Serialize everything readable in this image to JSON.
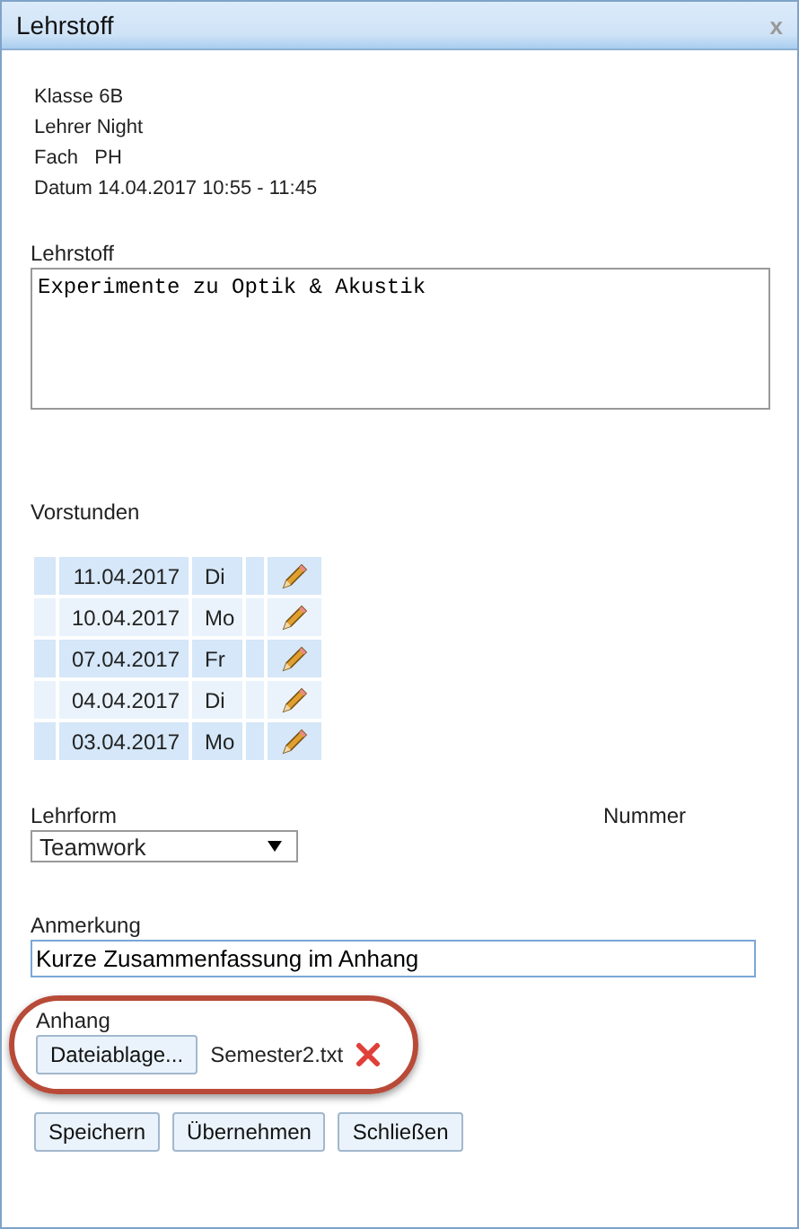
{
  "window": {
    "title": "Lehrstoff",
    "close": "x"
  },
  "info": [
    "Klasse 6B",
    "Lehrer Night",
    "Fach   PH",
    "Datum 14.04.2017 10:55 - 11:45"
  ],
  "lehrstoff": {
    "label": "Lehrstoff",
    "value": "Experimente zu Optik & Akustik"
  },
  "vorstunden": {
    "label": "Vorstunden",
    "rows": [
      {
        "date": "11.04.2017",
        "day": "Di"
      },
      {
        "date": "10.04.2017",
        "day": "Mo"
      },
      {
        "date": "07.04.2017",
        "day": "Fr"
      },
      {
        "date": "04.04.2017",
        "day": "Di"
      },
      {
        "date": "03.04.2017",
        "day": "Mo"
      }
    ]
  },
  "lehrform": {
    "label": "Lehrform",
    "value": "Teamwork"
  },
  "nummer": {
    "label": "Nummer"
  },
  "anmerkung": {
    "label": "Anmerkung",
    "value": "Kurze Zusammenfassung im Anhang"
  },
  "anhang": {
    "label": "Anhang",
    "button": "Dateiablage...",
    "file": "Semester2.txt",
    "highlighted": true
  },
  "buttons": [
    "Speichern",
    "Übernehmen",
    "Schließen"
  ]
}
